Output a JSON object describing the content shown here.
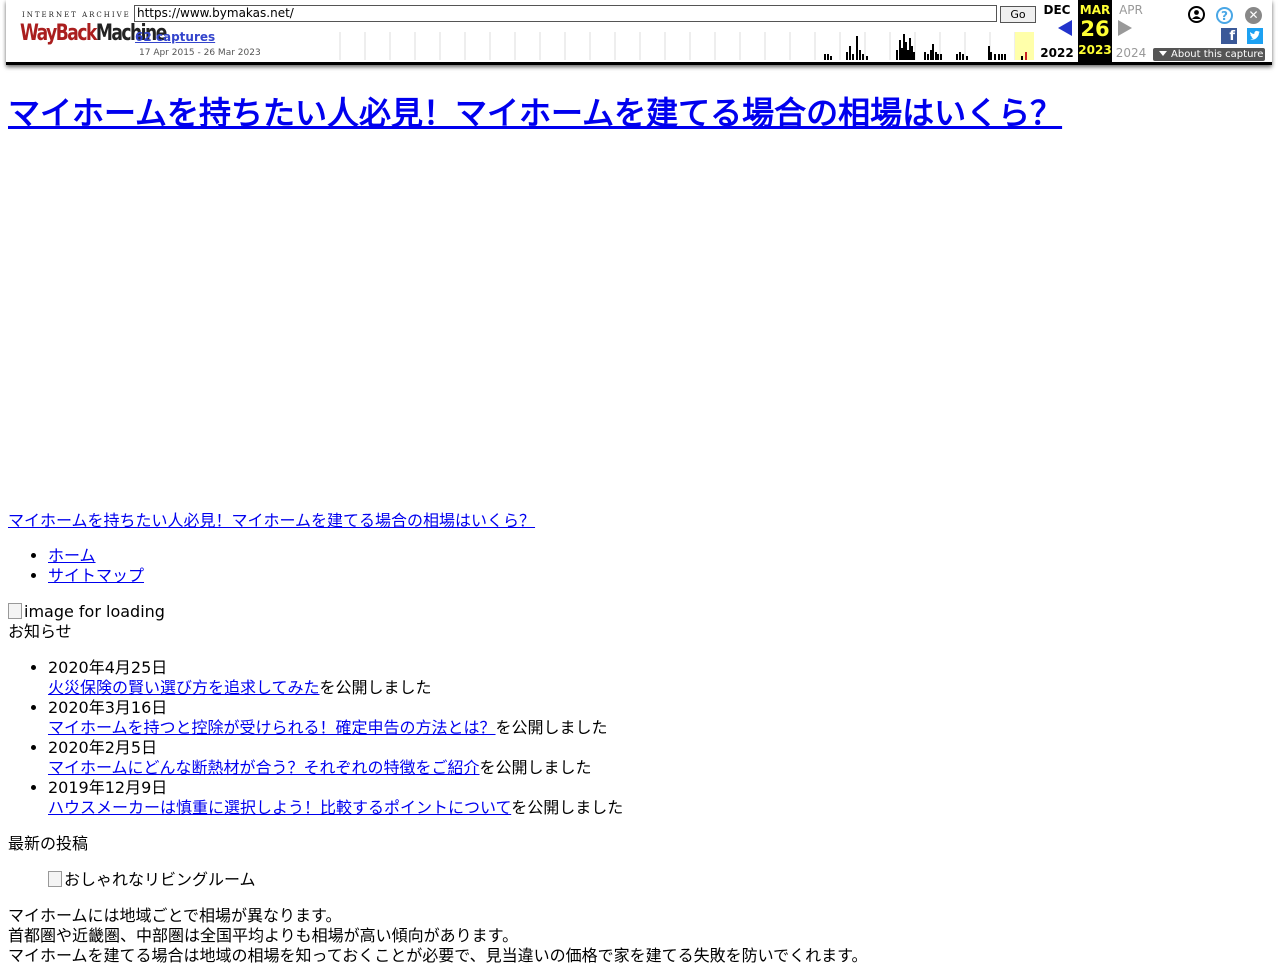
{
  "wayback": {
    "logo_top": "INTERNET ARCHIVE",
    "logo_wayback": "WayBack",
    "logo_machine": "Machine",
    "url": "https://www.bymakas.net/",
    "go_label": "Go",
    "captures_label": "62 captures",
    "date_range": "17 Apr 2015 - 26 Mar 2023",
    "prev": {
      "month": "DEC",
      "year": "2022"
    },
    "current": {
      "month": "MAR",
      "day": "26",
      "year": "2023"
    },
    "next": {
      "month": "APR",
      "year": "2024"
    },
    "about_label": "About this capture",
    "sparkline_capture_counts": [
      0,
      0,
      0,
      0,
      0,
      0,
      0,
      0,
      0,
      0,
      0,
      0,
      0,
      0,
      0,
      0,
      0,
      0,
      0,
      0,
      0,
      0,
      0,
      0,
      0,
      0,
      0,
      0,
      0,
      0,
      0,
      0,
      0,
      0,
      0,
      0,
      0,
      0,
      0,
      0,
      0,
      0,
      0,
      0,
      0,
      0,
      0,
      0,
      0,
      0,
      0,
      0,
      0,
      0,
      0,
      0,
      0,
      0,
      0,
      0,
      0,
      0,
      0,
      0,
      0,
      0,
      0,
      0,
      0,
      0,
      0,
      0,
      0,
      0,
      0,
      0,
      0,
      0,
      0,
      0,
      0,
      0,
      0,
      0,
      0,
      0,
      0,
      0,
      0,
      0,
      0,
      0,
      0,
      0,
      0,
      0,
      0,
      0,
      0,
      0,
      0,
      0,
      0,
      0,
      0,
      0,
      0,
      0,
      0,
      0,
      0,
      0,
      0,
      0,
      0,
      0,
      0,
      0,
      0,
      0,
      0,
      0,
      0,
      0,
      0,
      0,
      0,
      0,
      0,
      0,
      0,
      0,
      0,
      0,
      0,
      0,
      0,
      0,
      0,
      0,
      0,
      0,
      0,
      0,
      0,
      0,
      0,
      0,
      0,
      0,
      0,
      0,
      0,
      0,
      0,
      0,
      0,
      0,
      0,
      0,
      0,
      0,
      0,
      0,
      0,
      0,
      0,
      0,
      0,
      0,
      0,
      0,
      0,
      0,
      0,
      0,
      0,
      0,
      0,
      0,
      0,
      0,
      0,
      0,
      0,
      0,
      0,
      0,
      0,
      0,
      0,
      0,
      0,
      0,
      0,
      0,
      0,
      0,
      0,
      0,
      0,
      0,
      0,
      0,
      0,
      0,
      0,
      0,
      0,
      0,
      0,
      0,
      0,
      0,
      0,
      0,
      0,
      0,
      0,
      0,
      0,
      0,
      0,
      0,
      0,
      0,
      0,
      0,
      0,
      0,
      0,
      0,
      0,
      0,
      0,
      0,
      0,
      0,
      0,
      0,
      0,
      0,
      0,
      0,
      0,
      0,
      0,
      0,
      0,
      0,
      0,
      0,
      0,
      0,
      0,
      0,
      0,
      0,
      0,
      0,
      0,
      0,
      0,
      0,
      0,
      0,
      0,
      0,
      0,
      0,
      0,
      0,
      0,
      0,
      0,
      0,
      0,
      0,
      0,
      0,
      0,
      0,
      0,
      0,
      0,
      0,
      0,
      0,
      0,
      0,
      0,
      0,
      0,
      0,
      0,
      0,
      0,
      0,
      0,
      0,
      0,
      0,
      0,
      0,
      0,
      0,
      0,
      0,
      0,
      0,
      0,
      0,
      0,
      0,
      0,
      0,
      0,
      0,
      0,
      0,
      0,
      0,
      0,
      0,
      0,
      0,
      0,
      0,
      0,
      0,
      0,
      0,
      0,
      0,
      0,
      0,
      0,
      0,
      0,
      0,
      0,
      0,
      0,
      0,
      0,
      0,
      0,
      0,
      0,
      0,
      0,
      0,
      0,
      0,
      0,
      0,
      0,
      0,
      0,
      0,
      0,
      0,
      0,
      0,
      0,
      0,
      0,
      0,
      0,
      0,
      0,
      0,
      0,
      0,
      0,
      0,
      0,
      0,
      0,
      0,
      0,
      0,
      0,
      0,
      0,
      0,
      0,
      0,
      0,
      0,
      0,
      0,
      0,
      0,
      0,
      0,
      0,
      0,
      0,
      0,
      0,
      0,
      0,
      0,
      0,
      0,
      0,
      0,
      0,
      0,
      0,
      0,
      0,
      0,
      0,
      0,
      0,
      0,
      0,
      0,
      0,
      0,
      0,
      0,
      0,
      0,
      0,
      0,
      0,
      0,
      0,
      0,
      0,
      0,
      0,
      0,
      0,
      0,
      0,
      0,
      0,
      0,
      0,
      0,
      0,
      0,
      0,
      0,
      0,
      0,
      0,
      0,
      0,
      0,
      0,
      0,
      0,
      0,
      0,
      0,
      0,
      0,
      0,
      0,
      0,
      0,
      0,
      0,
      0,
      0,
      0,
      0,
      0,
      0,
      0,
      0,
      0,
      0,
      0,
      0,
      0,
      0,
      0,
      0,
      0,
      0,
      0,
      0,
      0,
      0,
      0,
      0,
      0,
      0,
      0,
      0,
      0,
      0,
      0,
      0,
      0,
      0,
      0,
      0,
      0,
      0,
      0,
      0,
      0,
      0,
      0,
      0,
      0,
      0,
      0,
      0,
      0,
      0,
      0,
      0,
      0,
      0,
      0,
      0,
      0,
      0,
      0,
      0,
      0,
      0,
      0,
      0,
      0,
      0,
      0,
      0,
      0,
      0,
      0,
      0,
      0,
      0,
      0,
      0,
      0,
      0,
      0,
      0,
      0,
      0,
      0,
      0,
      0,
      0,
      0,
      0,
      0,
      0,
      0,
      0,
      0,
      0,
      0,
      0,
      0,
      0,
      0,
      0,
      0,
      0,
      0,
      0,
      0,
      0,
      0,
      0,
      0,
      0,
      0,
      0,
      0,
      0,
      0,
      0,
      0,
      0,
      0,
      0,
      0,
      0,
      0,
      0,
      0,
      0,
      0,
      0,
      0,
      0,
      0,
      0,
      0,
      0,
      0,
      0,
      0,
      0,
      0,
      0,
      0,
      0,
      0,
      0,
      0,
      0,
      0,
      0,
      0,
      0,
      0,
      0,
      0,
      0,
      0,
      0,
      0,
      0,
      0,
      0,
      0,
      0,
      0,
      0,
      0,
      0,
      0,
      0,
      0,
      0,
      0,
      0,
      0,
      0,
      0,
      0,
      0,
      0,
      0,
      0,
      0,
      0,
      0,
      0,
      0,
      0,
      0,
      0,
      0,
      0,
      0,
      0,
      0,
      0,
      0,
      0,
      0,
      0,
      0,
      0,
      0,
      0,
      0,
      0,
      0,
      0,
      0,
      0,
      0,
      0,
      0,
      0,
      0,
      0,
      0,
      0,
      0,
      0,
      0,
      0,
      0,
      0,
      0,
      0,
      0,
      0,
      0,
      0,
      0,
      0,
      0,
      0,
      0,
      0,
      0,
      0,
      0,
      0,
      0,
      0,
      0,
      0,
      0,
      0,
      0,
      0,
      0,
      0,
      0,
      0,
      0,
      0,
      0,
      0,
      0,
      0,
      0,
      0,
      0,
      0,
      0,
      0,
      0,
      0,
      0,
      0,
      0,
      0,
      0,
      0,
      0,
      0,
      0,
      0,
      0,
      0,
      0,
      0,
      0,
      0,
      0,
      0,
      0,
      0,
      0,
      0,
      0,
      0,
      0,
      0,
      0,
      0,
      0,
      0,
      0,
      0,
      0,
      0,
      0,
      0,
      0,
      0,
      0,
      0,
      0,
      0,
      0,
      0,
      0,
      0,
      0,
      0,
      0,
      0,
      0,
      0,
      0,
      0,
      0,
      0,
      0,
      0,
      0,
      0,
      0,
      0,
      0,
      0,
      0,
      0,
      0,
      0,
      0,
      0,
      0,
      0,
      0,
      0,
      0,
      0,
      0,
      0,
      0,
      0
    ],
    "colors": {
      "current_bg": "#000000",
      "current_fg": "#ffff33",
      "highlight": "#ffffaa",
      "logo_red": "#aa1e1e"
    }
  },
  "site": {
    "title": "マイホームを持ちたい人必見！マイホームを建てる場合の相場はいくら？",
    "header_link": "マイホームを持ちたい人必見！マイホームを建てる場合の相場はいくら？",
    "nav": [
      {
        "label": "ホーム"
      },
      {
        "label": "サイトマップ"
      }
    ],
    "loading_alt": "image for loading",
    "notice_heading": "お知らせ",
    "notices": [
      {
        "date": "2020年4月25日",
        "link": "火災保険の賢い選び方を追求してみた",
        "suffix": "を公開しました"
      },
      {
        "date": "2020年3月16日",
        "link": "マイホームを持つと控除が受けられる！確定申告の方法とは？",
        "suffix": "を公開しました"
      },
      {
        "date": "2020年2月5日",
        "link": "マイホームにどんな断熱材が合う？それぞれの特徴をご紹介",
        "suffix": "を公開しました"
      },
      {
        "date": "2019年12月9日",
        "link": "ハウスメーカーは慎重に選択しよう！比較するポイントについて",
        "suffix": "を公開しました"
      }
    ],
    "latest_heading": "最新の投稿",
    "post_image_alt": "おしゃれなリビングルーム",
    "post_lines": [
      "マイホームには地域ごとで相場が異なります。",
      "首都圏や近畿圏、中部圏は全国平均よりも相場が高い傾向があります。",
      "マイホームを建てる場合は地域の相場を知っておくことが必要で、見当違いの価格で家を建てる失敗を防いでくれます。"
    ]
  }
}
